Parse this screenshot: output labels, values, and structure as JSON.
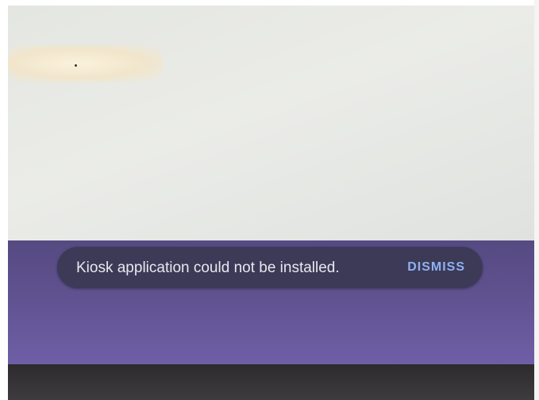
{
  "notification": {
    "message": "Kiosk application could not be installed.",
    "action_label": "DISMISS"
  },
  "colors": {
    "shelf": "#5e518e",
    "snackbar_background": "#3c3a57",
    "snackbar_text": "#e8e8ee",
    "action_accent": "#8fb0f3"
  }
}
